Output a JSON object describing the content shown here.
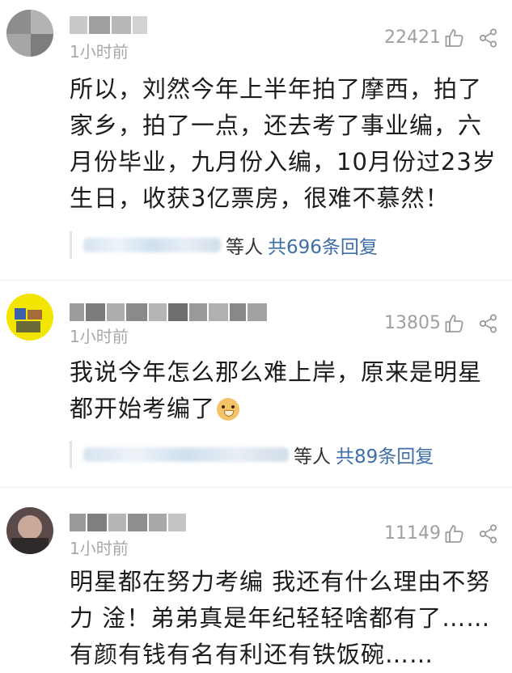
{
  "comments": [
    {
      "time": "1小时前",
      "likes": "22421",
      "text": "所以，刘然今年上半年拍了摩西，拍了家乡，拍了一点，还去考了事业编，六月份毕业，九月份入编，10月份过23岁生日，收获3亿票房，很难不慕然！",
      "reply_suffix": "等人",
      "reply_total": "共696条回复"
    },
    {
      "time": "1小时前",
      "likes": "13805",
      "text": "我说今年怎么那么难上岸，原来是明星都开始考编了",
      "emoji": "doge-emoji",
      "reply_suffix": "等人",
      "reply_total": "共89条回复"
    },
    {
      "time": "1小时前",
      "likes": "11149",
      "text": "明星都在努力考编 我还有什么理由不努力 淦！弟弟真是年纪轻轻啥都有了……有颜有钱有名有利还有铁饭碗……"
    }
  ],
  "icons": {
    "like": "thumbs-up-icon",
    "share": "share-icon"
  },
  "colors": {
    "reply_link": "#3d6ea8",
    "meta_gray": "#a0a0a0"
  }
}
